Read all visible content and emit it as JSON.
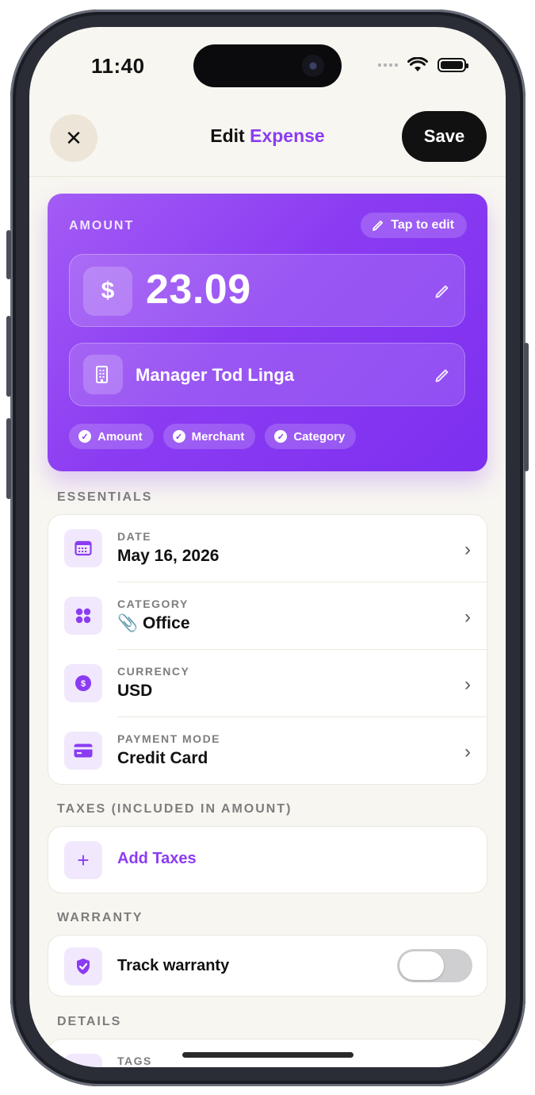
{
  "status": {
    "time": "11:40"
  },
  "header": {
    "title_main": "Edit",
    "title_accent": "Expense",
    "save_label": "Save",
    "close_glyph": "✕"
  },
  "amount_card": {
    "label": "AMOUNT",
    "tap_to_edit": "Tap to edit",
    "currency_symbol": "$",
    "amount": "23.09",
    "merchant": "Manager Tod Linga",
    "chips": [
      "Amount",
      "Merchant",
      "Category"
    ]
  },
  "essentials": {
    "label": "ESSENTIALS",
    "rows": [
      {
        "key": "DATE",
        "value": "May 16, 2026",
        "icon": "calendar-icon"
      },
      {
        "key": "CATEGORY",
        "value": "📎 Office",
        "icon": "grid-icon"
      },
      {
        "key": "CURRENCY",
        "value": "USD",
        "icon": "dollar-coin-icon"
      },
      {
        "key": "PAYMENT MODE",
        "value": "Credit Card",
        "icon": "credit-card-icon"
      }
    ]
  },
  "taxes": {
    "label": "TAXES (INCLUDED IN AMOUNT)",
    "add_label": "Add Taxes"
  },
  "warranty": {
    "label": "WARRANTY",
    "toggle_label": "Track warranty",
    "enabled": false
  },
  "details": {
    "label": "DETAILS",
    "first_row_key": "TAGS"
  },
  "colors": {
    "accent": "#8b3cf2",
    "background": "#f8f6f1",
    "card": "#ffffff",
    "dark": "#111111"
  }
}
